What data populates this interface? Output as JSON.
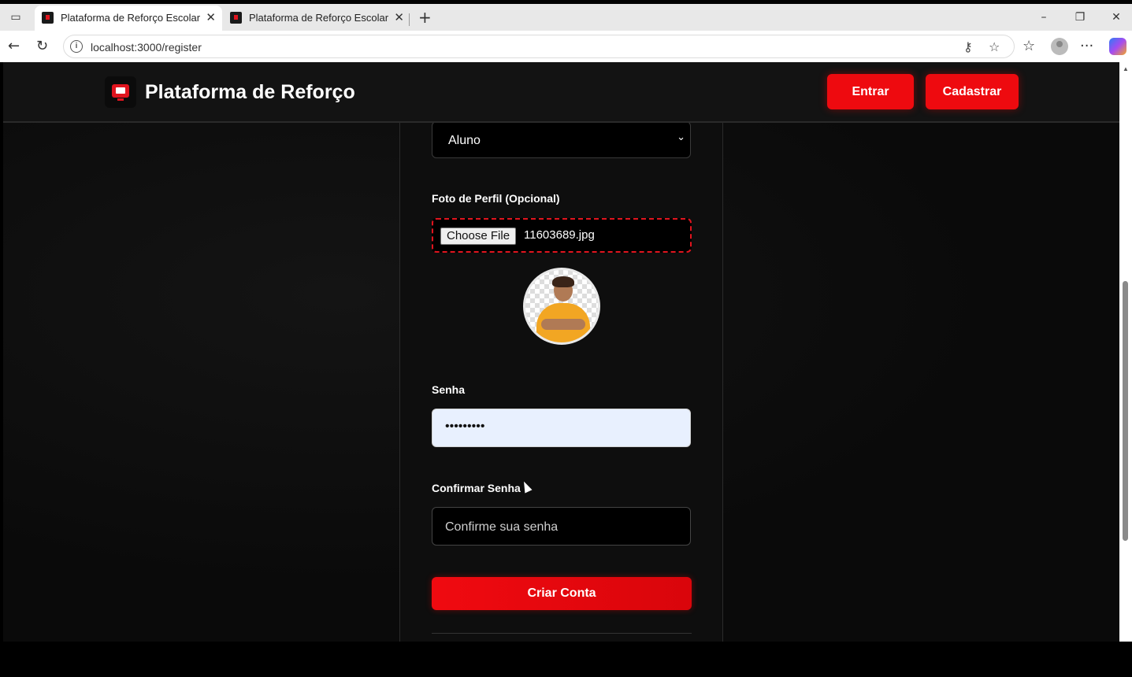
{
  "browser": {
    "tabs": [
      {
        "title": "Plataforma de Reforço Escolar",
        "active": true
      },
      {
        "title": "Plataforma de Reforço Escolar",
        "active": false
      }
    ],
    "url": "localhost:3000/register",
    "icons": {
      "back": "back-arrow-icon",
      "reload": "reload-icon",
      "info": "info-icon",
      "key": "key-icon",
      "favorite": "star-icon",
      "favorites": "favorites-icon",
      "profile": "profile-icon",
      "menu": "more-icon",
      "copilot": "copilot-icon"
    }
  },
  "site": {
    "brand": "Plataforma de Reforço",
    "nav": {
      "login": "Entrar",
      "register": "Cadastrar"
    },
    "accent_color": "#ee0a0f"
  },
  "form": {
    "role_select": {
      "value": "Aluno"
    },
    "photo": {
      "label": "Foto de Perfil (Opcional)",
      "button": "Choose File",
      "filename": "11603689.jpg"
    },
    "password": {
      "label": "Senha",
      "value": "•••••••••"
    },
    "confirm_password": {
      "label": "Confirmar Senha",
      "placeholder": "Confirme sua senha"
    },
    "submit": "Criar Conta"
  }
}
